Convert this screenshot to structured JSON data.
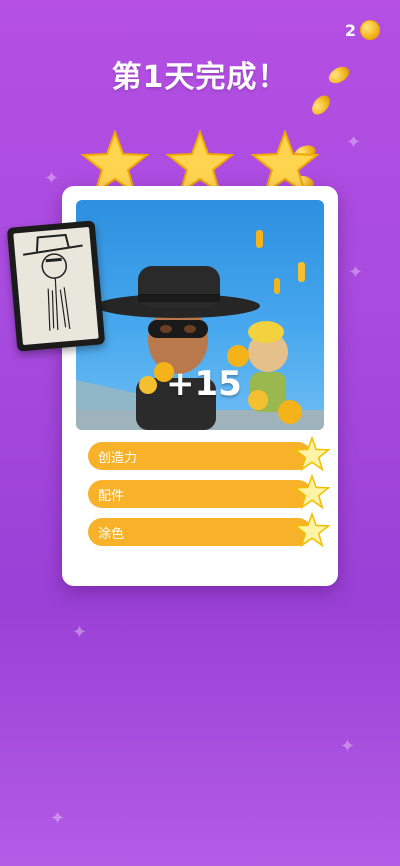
{
  "coins": {
    "count": "2"
  },
  "title": "第1天完成！",
  "stars": {
    "earned": 3,
    "total": 3
  },
  "card": {
    "reward": "+15",
    "criteria": [
      {
        "label": "创造力"
      },
      {
        "label": "配件"
      },
      {
        "label": "涂色"
      }
    ]
  },
  "colors": {
    "background": "#a84bdf",
    "accent": "#f7b22a",
    "star": "#ffd54f"
  }
}
